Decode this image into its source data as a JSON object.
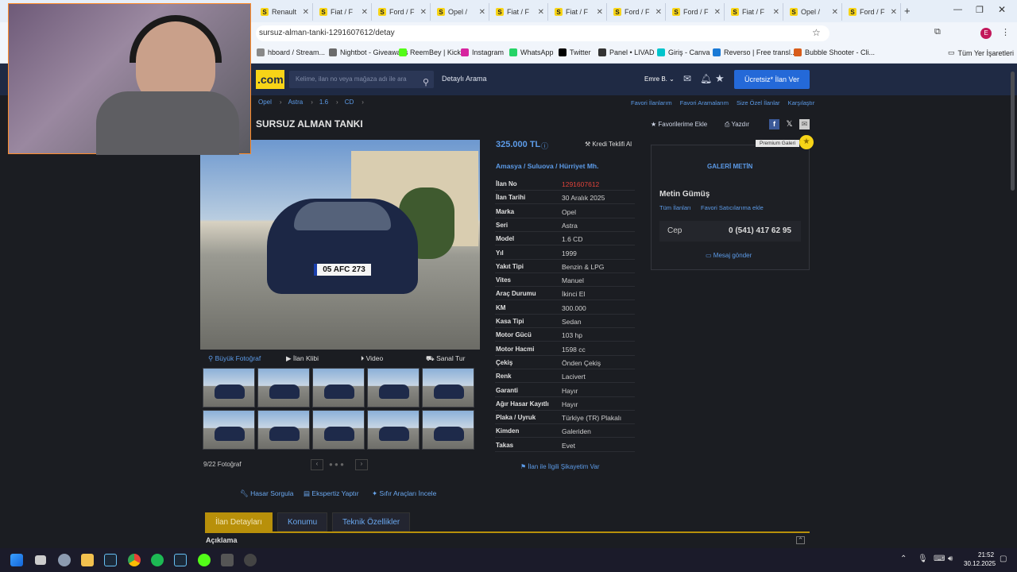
{
  "browser": {
    "tabs": [
      {
        "label": "Renault",
        "icon": "sahibinden-favicon"
      },
      {
        "label": "Fiat / F",
        "icon": "sahibinden-favicon"
      },
      {
        "label": "Ford / F",
        "icon": "sahibinden-favicon"
      },
      {
        "label": "Opel / ",
        "icon": "sahibinden-favicon"
      },
      {
        "label": "Fiat / F",
        "icon": "sahibinden-favicon"
      },
      {
        "label": "Fiat / F",
        "icon": "sahibinden-favicon"
      },
      {
        "label": "Ford / F",
        "icon": "sahibinden-favicon"
      },
      {
        "label": "Ford / F",
        "icon": "sahibinden-favicon"
      },
      {
        "label": "Fiat / F",
        "icon": "sahibinden-favicon"
      },
      {
        "label": "Opel / ",
        "icon": "sahibinden-favicon"
      },
      {
        "label": "Ford / F",
        "icon": "sahibinden-favicon"
      }
    ],
    "url": "sursuz-alman-tanki-1291607612/detay",
    "bookmarks": [
      "hboard / Stream...",
      "Nightbot - Giveaways",
      "ReemBey | Kick",
      "Instagram",
      "WhatsApp",
      "Twitter",
      "Panel • LIVAD",
      "Giriş - Canva",
      "Reverso | Free transl...",
      "Bubble Shooter - Cli..."
    ],
    "all_bookmarks": "Tüm Yer İşaretleri",
    "profile_initial": "E"
  },
  "site": {
    "logo": ".com",
    "search_placeholder": "Kelime, ilan no veya mağaza adı ile ara",
    "detailed_search": "Detaylı Arama",
    "user": "Emre B.",
    "post_ad": "Ücretsiz* İlan Ver",
    "breadcrumb": [
      "Opel",
      "Astra",
      "1.6",
      "CD"
    ],
    "top_links": [
      "Favori İlanlarım",
      "Favori Aramalarım",
      "Size Özel İlanlar",
      "Karşılaştır"
    ],
    "title": "SURSUZ ALMAN TANKI",
    "add_fav": "Favorilerime Ekle",
    "print": "Yazdır"
  },
  "listing": {
    "price": "325.000 TL",
    "credit": "Kredi Teklifi Al",
    "location": [
      "Amasya",
      "Suluova",
      "Hürriyet Mh."
    ],
    "rows": [
      {
        "label": "İlan No",
        "value": "1291607612",
        "color": "#e0433a"
      },
      {
        "label": "İlan Tarihi",
        "value": "30 Aralık 2025"
      },
      {
        "label": "Marka",
        "value": "Opel"
      },
      {
        "label": "Seri",
        "value": "Astra"
      },
      {
        "label": "Model",
        "value": "1.6 CD"
      },
      {
        "label": "Yıl",
        "value": "1999"
      },
      {
        "label": "Yakıt Tipi",
        "value": "Benzin & LPG"
      },
      {
        "label": "Vites",
        "value": "Manuel"
      },
      {
        "label": "Araç Durumu",
        "value": "İkinci El"
      },
      {
        "label": "KM",
        "value": "300.000"
      },
      {
        "label": "Kasa Tipi",
        "value": "Sedan"
      },
      {
        "label": "Motor Gücü",
        "value": "103 hp"
      },
      {
        "label": "Motor Hacmi",
        "value": "1598 cc"
      },
      {
        "label": "Çekiş",
        "value": "Önden Çekiş"
      },
      {
        "label": "Renk",
        "value": "Lacivert"
      },
      {
        "label": "Garanti",
        "value": "Hayır"
      },
      {
        "label": "Ağır Hasar Kayıtlı",
        "value": "Hayır"
      },
      {
        "label": "Plaka / Uyruk",
        "value": "Türkiye (TR) Plakalı"
      },
      {
        "label": "Kimden",
        "value": "Galeriden"
      },
      {
        "label": "Takas",
        "value": "Evet"
      }
    ],
    "complaint": "İlan ile İlgili Şikayetim Var",
    "plate": "05 AFC 273"
  },
  "media": {
    "big_photo": "Büyük Fotoğraf",
    "ad_clip": "İlan Klibi",
    "video": "Video",
    "virtual_tour": "Sanal Tur",
    "photo_counter": "9/22 Fotoğraf"
  },
  "seller": {
    "premium": "Premium Galeri",
    "gallery": "GALERİ METİN",
    "name": "Metin Gümüş",
    "all_ads": "Tüm İlanları",
    "add_fav_seller": "Favori Satıcılarıma ekle",
    "phone_label": "Cep",
    "phone": "0 (541) 417 62 95",
    "message": "Mesaj gönder"
  },
  "actions": [
    "Hasar Sorgula",
    "Ekspertiz Yaptır",
    "Sıfır Araçları İncele"
  ],
  "tabs": [
    "İlan Detayları",
    "Konumu",
    "Teknik Özellikler"
  ],
  "description_header": "Açıklama",
  "taskbar": {
    "time": "21:52",
    "date": "30.12.2025"
  },
  "colors": {
    "accent": "#f7d417",
    "link": "#5c9be8",
    "brand_blue": "#2469d8"
  }
}
